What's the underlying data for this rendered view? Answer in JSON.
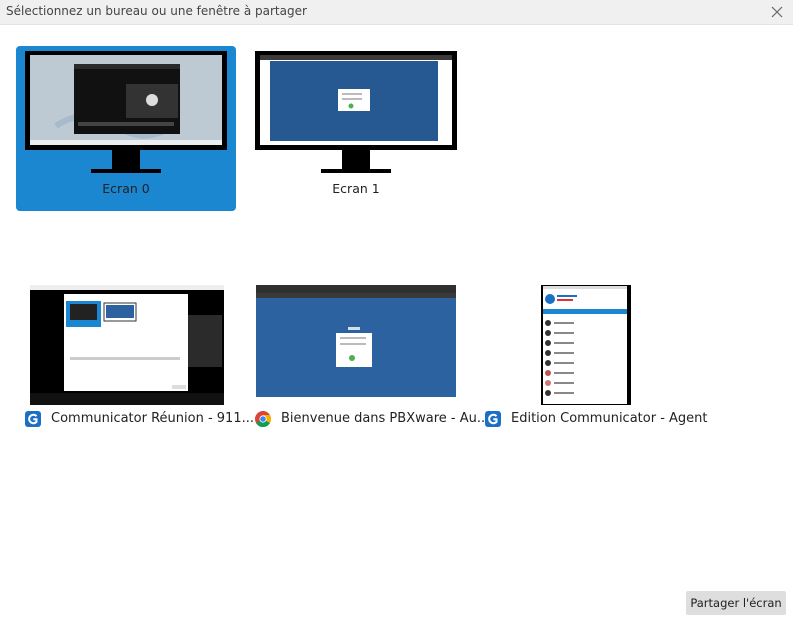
{
  "dialog": {
    "title": "Sélectionnez un bureau ou une fenêtre à partager",
    "close_icon": "close-icon"
  },
  "screens": [
    {
      "label": "Ecran 0",
      "selected": true
    },
    {
      "label": "Ecran 1",
      "selected": false
    }
  ],
  "windows": [
    {
      "label": "Communicator Réunion - 911...",
      "icon": "communicator-app-icon"
    },
    {
      "label": "Bienvenue dans PBXware - Au...",
      "icon": "chrome-browser-icon"
    },
    {
      "label": "Edition Communicator - Agent",
      "icon": "communicator-app-icon"
    }
  ],
  "actions": {
    "share_label": "Partager l'écran"
  },
  "colors": {
    "selected_bg": "#1b87d0",
    "accent": "#1b87d0",
    "button_bg": "#dedede"
  }
}
